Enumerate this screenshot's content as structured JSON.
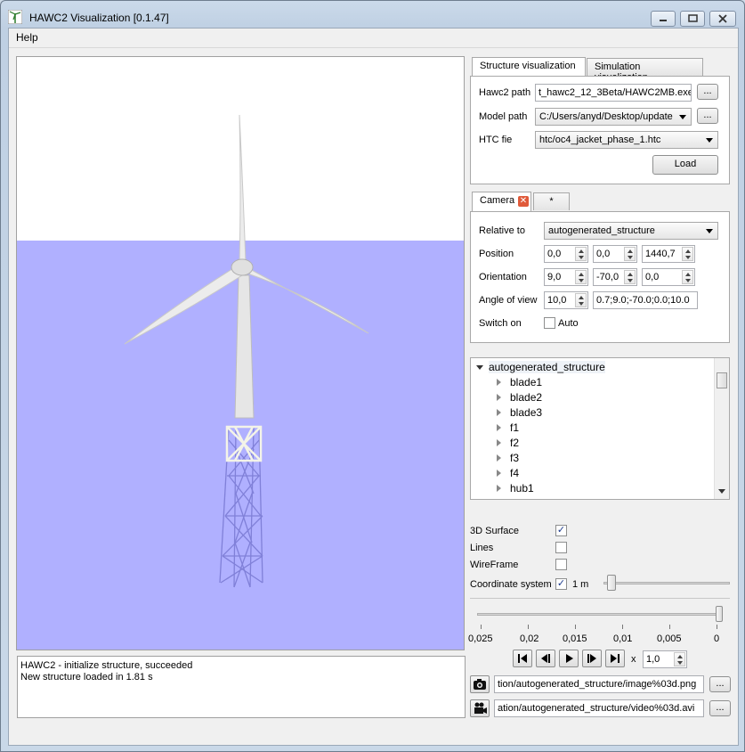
{
  "window": {
    "title": "HAWC2 Visualization [0.1.47]"
  },
  "menu": {
    "help": "Help"
  },
  "tabs": {
    "structure": "Structure visualization",
    "simulation": "Simulation visualization"
  },
  "structure": {
    "hawc2_path_label": "Hawc2 path",
    "hawc2_path_value": "t_hawc2_12_3Beta/HAWC2MB.exe",
    "model_path_label": "Model path",
    "model_path_value": "C:/Users/anyd/Desktop/update",
    "htc_label": "HTC fie",
    "htc_value": "htc/oc4_jacket_phase_1.htc",
    "browse": "...",
    "load": "Load"
  },
  "camera": {
    "tab": "Camera",
    "tab_new": "*",
    "relative_label": "Relative to",
    "relative_value": "autogenerated_structure",
    "position_label": "Position",
    "position": [
      "0,0",
      "0,0",
      "1440,7"
    ],
    "orientation_label": "Orientation",
    "orientation": [
      "9,0",
      "-70,0",
      "0,0"
    ],
    "angle_label": "Angle of view",
    "angle": "10,0",
    "angle_str": "0.7;9.0;-70.0;0.0;10.0",
    "switch_label": "Switch on",
    "auto_label": "Auto"
  },
  "tree": {
    "root": "autogenerated_structure",
    "children": [
      "blade1",
      "blade2",
      "blade3",
      "f1",
      "f2",
      "f3",
      "f4",
      "hub1"
    ]
  },
  "options": {
    "surface": "3D Surface",
    "lines": "Lines",
    "wireframe": "WireFrame",
    "coord": "Coordinate system",
    "coord_size": "1 m",
    "surface_checked": true,
    "lines_checked": false,
    "wireframe_checked": false,
    "coord_checked": true
  },
  "timeline": {
    "ticks": [
      "0,025",
      "0,02",
      "0,015",
      "0,01",
      "0,005",
      "0"
    ],
    "speed_prefix": "x",
    "speed": "1,0",
    "image_path": "tion/autogenerated_structure/image%03d.png",
    "video_path": "ation/autogenerated_structure/video%03d.avi"
  },
  "log": {
    "lines": [
      "HAWC2 - initialize structure, succeeded",
      "New structure loaded in 1.81 s"
    ]
  },
  "colors": {
    "sky": "#ffffff",
    "sea": "#b0b0ff",
    "turbine": "#e8e8e8",
    "jacket": "#8c8ce0"
  }
}
